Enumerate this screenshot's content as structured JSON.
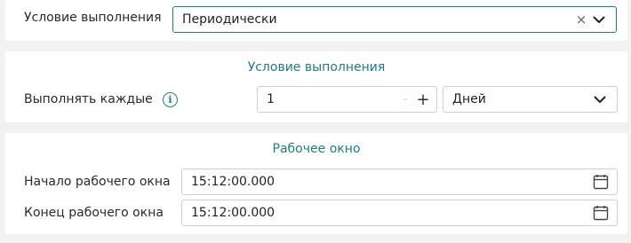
{
  "execution": {
    "label": "Условие выполнения",
    "selected": "Периодически"
  },
  "period_section": {
    "title": "Условие выполнения",
    "repeat_label": "Выполнять каждые",
    "count_value": "1",
    "minus_symbol": "-",
    "plus_symbol": "+",
    "unit_value": "Дней"
  },
  "window_section": {
    "title": "Рабочее окно",
    "start_label": "Начало рабочего окна",
    "start_value": "15:12:00.000",
    "end_label": "Конец рабочего окна",
    "end_value": "15:12:00.000"
  },
  "colors": {
    "accent": "#1a7f86",
    "background": "#f2f2f2",
    "card": "#ffffff",
    "border": "#cfcfcf"
  },
  "icons": {
    "clear": "close-icon",
    "dropdown": "chevron-down-icon",
    "info": "info-icon",
    "calendar": "calendar-icon"
  }
}
